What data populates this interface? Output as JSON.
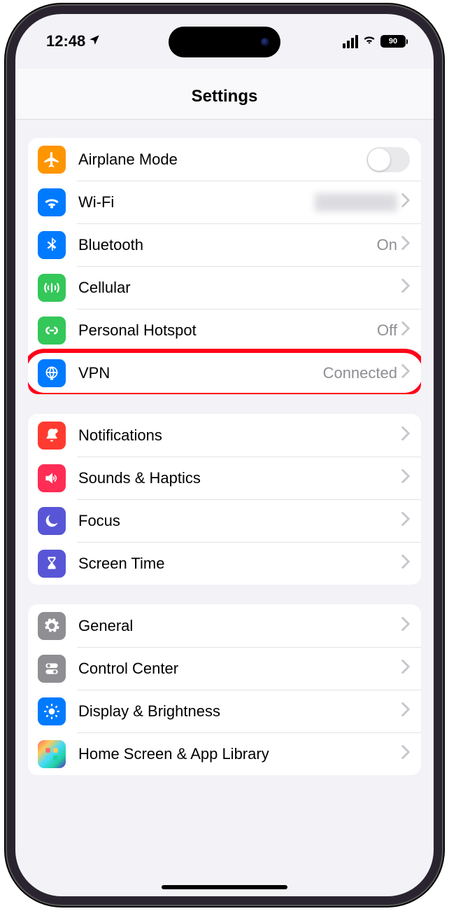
{
  "status": {
    "time": "12:48",
    "battery": "90"
  },
  "header": {
    "title": "Settings"
  },
  "highlight_row": "vpn",
  "groups": [
    {
      "rows": [
        {
          "id": "airplane",
          "icon": "airplane-icon",
          "color": "bg-orange",
          "label": "Airplane Mode",
          "accessory": "toggle",
          "toggle_on": false
        },
        {
          "id": "wifi",
          "icon": "wifi-icon",
          "color": "bg-blue",
          "label": "Wi-Fi",
          "accessory": "disclosure",
          "detail_blurred": true
        },
        {
          "id": "bluetooth",
          "icon": "bluetooth-icon",
          "color": "bg-blue",
          "label": "Bluetooth",
          "accessory": "disclosure",
          "detail": "On"
        },
        {
          "id": "cellular",
          "icon": "cellular-icon",
          "color": "bg-green",
          "label": "Cellular",
          "accessory": "disclosure"
        },
        {
          "id": "hotspot",
          "icon": "hotspot-icon",
          "color": "bg-green",
          "label": "Personal Hotspot",
          "accessory": "disclosure",
          "detail": "Off"
        },
        {
          "id": "vpn",
          "icon": "vpn-icon",
          "color": "bg-blue",
          "label": "VPN",
          "accessory": "disclosure",
          "detail": "Connected"
        }
      ]
    },
    {
      "rows": [
        {
          "id": "notifications",
          "icon": "notifications-icon",
          "color": "bg-red",
          "label": "Notifications",
          "accessory": "disclosure"
        },
        {
          "id": "sounds",
          "icon": "sounds-icon",
          "color": "bg-pink",
          "label": "Sounds & Haptics",
          "accessory": "disclosure"
        },
        {
          "id": "focus",
          "icon": "focus-icon",
          "color": "bg-indigo",
          "label": "Focus",
          "accessory": "disclosure"
        },
        {
          "id": "screentime",
          "icon": "screentime-icon",
          "color": "bg-indigo",
          "label": "Screen Time",
          "accessory": "disclosure"
        }
      ]
    },
    {
      "rows": [
        {
          "id": "general",
          "icon": "general-icon",
          "color": "bg-gray",
          "label": "General",
          "accessory": "disclosure"
        },
        {
          "id": "controlcenter",
          "icon": "controlcenter-icon",
          "color": "bg-gray",
          "label": "Control Center",
          "accessory": "disclosure"
        },
        {
          "id": "display",
          "icon": "display-icon",
          "color": "bg-blue",
          "label": "Display & Brightness",
          "accessory": "disclosure"
        },
        {
          "id": "homescreen",
          "icon": "homescreen-icon",
          "color": "bg-colorful",
          "label": "Home Screen & App Library",
          "accessory": "disclosure"
        }
      ]
    }
  ]
}
